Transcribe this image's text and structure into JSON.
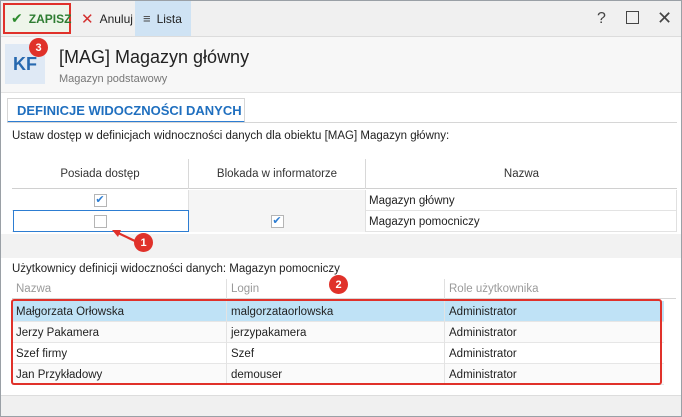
{
  "toolbar": {
    "save_label": "ZAPISZ",
    "cancel_label": "Anuluj",
    "list_label": "Lista",
    "help_glyph": "?",
    "close_glyph": "✕"
  },
  "badges": {
    "b1": "1",
    "b2": "2",
    "b3": "3"
  },
  "header": {
    "logo_text": "KF",
    "title": "[MAG] Magazyn główny",
    "subtitle": "Magazyn podstawowy"
  },
  "section_tab": "DEFINICJE WIDOCZNOŚCI DANYCH",
  "description": "Ustaw dostęp w definicjach widnoczności danych dla obiektu [MAG] Magazyn główny:",
  "access_grid": {
    "columns": [
      "Posiada dostęp",
      "Blokada w informatorze",
      "Nazwa"
    ],
    "rows": [
      {
        "has_access": true,
        "blocked": false,
        "name": "Magazyn główny"
      },
      {
        "has_access": false,
        "blocked": true,
        "name": "Magazyn pomocniczy"
      }
    ]
  },
  "users": {
    "title": "Użytkownicy definicji widoczności danych: Magazyn pomocniczy",
    "columns": [
      "Nazwa",
      "Login",
      "Role użytkownika"
    ],
    "rows": [
      {
        "name": "Małgorzata Orłowska",
        "login": "malgorzataorlowska",
        "role": "Administrator"
      },
      {
        "name": "Jerzy Pakamera",
        "login": "jerzypakamera",
        "role": "Administrator"
      },
      {
        "name": "Szef firmy",
        "login": "Szef",
        "role": "Administrator"
      },
      {
        "name": "Jan Przykładowy",
        "login": "demouser",
        "role": "Administrator"
      }
    ]
  },
  "colors": {
    "accent_blue": "#2d7dd2",
    "highlight_red": "#e0312a",
    "selected_row": "#bfe2f6",
    "save_green": "#2e7d32"
  }
}
